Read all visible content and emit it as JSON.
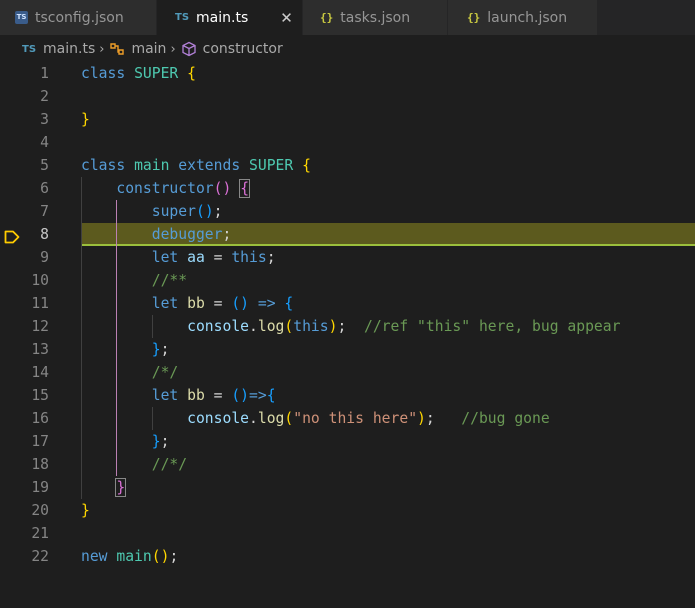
{
  "tabs": [
    {
      "label": "tsconfig.json",
      "icon": "typescript-config-icon",
      "active": false
    },
    {
      "label": "main.ts",
      "icon": "typescript-file-icon",
      "active": true,
      "close": "✕"
    },
    {
      "label": "tasks.json",
      "icon": "json-file-icon",
      "active": false
    },
    {
      "label": "launch.json",
      "icon": "json-file-icon",
      "active": false
    }
  ],
  "icons": {
    "ts_badge": "TS",
    "ts_text": "TS",
    "json": "{}"
  },
  "breadcrumb": {
    "file": "main.ts",
    "class": "main",
    "member": "constructor",
    "separator": "›"
  },
  "line_numbers": [
    "1",
    "2",
    "3",
    "4",
    "5",
    "6",
    "7",
    "8",
    "9",
    "10",
    "11",
    "12",
    "13",
    "14",
    "15",
    "16",
    "17",
    "18",
    "19",
    "20",
    "21",
    "22"
  ],
  "current_line_index": 7,
  "code": [
    [
      "class",
      " ",
      "SUPER",
      " ",
      "{"
    ],
    [],
    [
      "}"
    ],
    [],
    [
      "class",
      " ",
      "main",
      " ",
      "extends",
      " ",
      "SUPER",
      " ",
      "{"
    ],
    [
      "    ",
      "constructor",
      "(",
      ")",
      " ",
      "{"
    ],
    [
      "        ",
      "super",
      "(",
      ")",
      ";"
    ],
    [
      "        ",
      "debugger",
      ";"
    ],
    [
      "        ",
      "let",
      " ",
      "aa",
      " = ",
      "this",
      ";"
    ],
    [
      "        ",
      "//**"
    ],
    [
      "        ",
      "let",
      " ",
      "bb",
      " = ",
      "()",
      " ",
      "=>",
      " ",
      "{"
    ],
    [
      "            ",
      "console",
      ".",
      "log",
      "(",
      "this",
      ");",
      "  ",
      "//ref \"this\" here, bug appear"
    ],
    [
      "        ",
      "};"
    ],
    [
      "        ",
      "/*/"
    ],
    [
      "        ",
      "let",
      " ",
      "bb",
      " = ",
      "()",
      "=>",
      "{"
    ],
    [
      "            ",
      "console",
      ".",
      "log",
      "(",
      "\"no this here\"",
      ");",
      "   ",
      "//bug gone"
    ],
    [
      "        ",
      "};"
    ],
    [
      "        ",
      "//*/"
    ],
    [
      "    ",
      "}"
    ],
    [
      "}"
    ],
    [],
    [
      "new",
      " ",
      "main",
      "()",
      ";"
    ]
  ],
  "colors": {
    "keyword": "#569cd6",
    "class_name": "#4ec9b0",
    "function": "#dcdcaa",
    "comment": "#6a9955",
    "string": "#ce9178",
    "variable": "#9cdcfe",
    "bracket_level1": "#ffd700",
    "bracket_level2": "#da70d6",
    "bracket_level3": "#179fff",
    "current_line_bg": "#5c5a1e",
    "breakpoint": "#ffcc00"
  }
}
